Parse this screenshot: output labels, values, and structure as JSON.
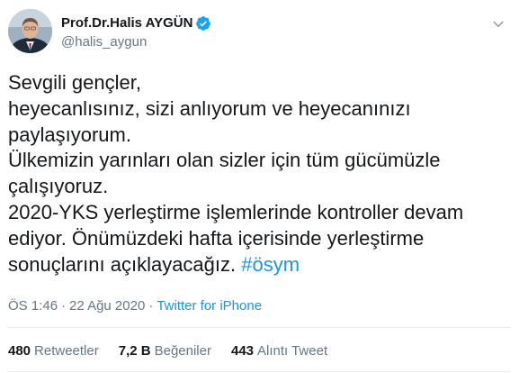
{
  "author": {
    "display_name": "Prof.Dr.Halis AYGÜN",
    "handle": "@halis_aygun",
    "verified": true
  },
  "tweet": {
    "lines": [
      "Sevgili gençler,",
      "heyecanlısınız, sizi anlıyorum ve heyecanınızı",
      "paylaşıyorum.",
      "Ülkemizin yarınları olan sizler için tüm gücümüzle",
      "çalışıyoruz.",
      "2020-YKS yerleştirme işlemlerinde kontroller devam",
      "ediyor. Önümüzdeki hafta içerisinde yerleştirme",
      "sonuçlarını açıklayacağız."
    ],
    "hashtag": "#ösym"
  },
  "meta": {
    "time": "ÖS 1:46",
    "date": "22 Ağu 2020",
    "separator": "·",
    "source": "Twitter for iPhone"
  },
  "stats": {
    "retweets_count": "480",
    "retweets_label": "Retweetler",
    "likes_count": "7,2 B",
    "likes_label": "Beğeniler",
    "quotes_count": "443",
    "quotes_label": "Alıntı Tweet"
  },
  "colors": {
    "text": "#14171a",
    "secondary": "#657786",
    "link": "#1b95e0",
    "verified": "#1da1f2",
    "divider": "#e6ecf0"
  },
  "icons": {
    "verified": "verified-badge-icon",
    "menu": "chevron-down-icon"
  }
}
